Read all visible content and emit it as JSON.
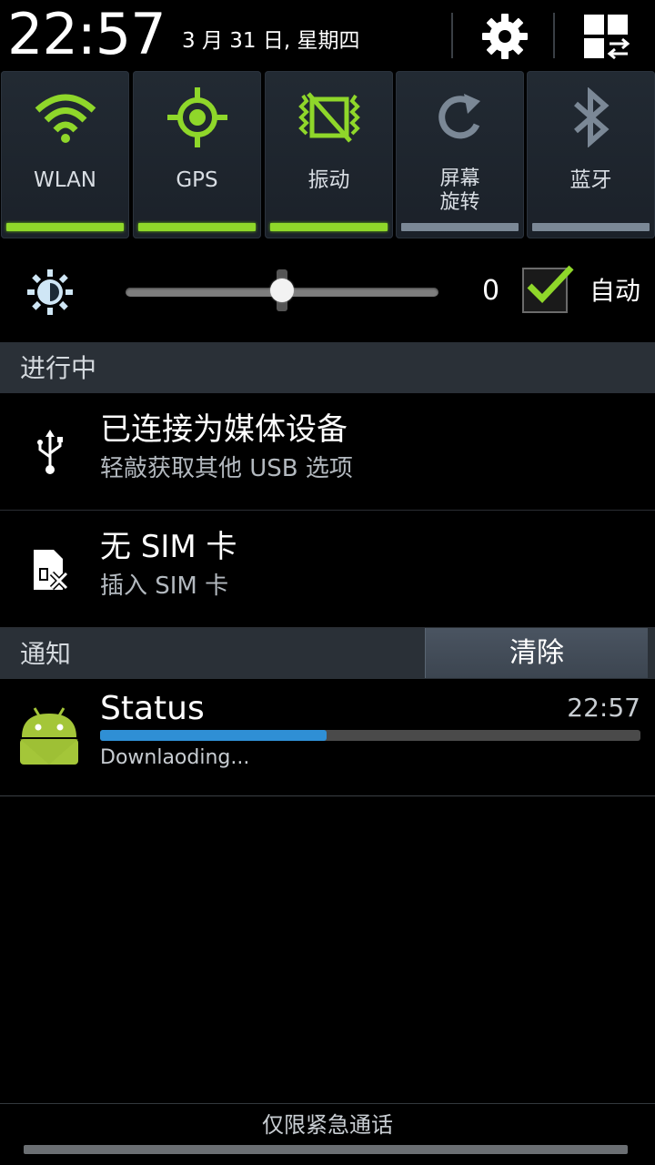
{
  "header": {
    "time": "22:57",
    "date": "3 月 31 日, 星期四",
    "icons": [
      "gear-icon",
      "grid-swap-icon"
    ]
  },
  "toggles": [
    {
      "label": "WLAN",
      "icon": "wifi-icon",
      "on": true
    },
    {
      "label": "GPS",
      "icon": "gps-icon",
      "on": true
    },
    {
      "label": "振动",
      "icon": "vibrate-icon",
      "on": true
    },
    {
      "label": "屏幕\n旋转",
      "label_line1": "屏幕",
      "label_line2": "旋转",
      "icon": "rotate-icon",
      "on": false
    },
    {
      "label": "蓝牙",
      "icon": "bluetooth-icon",
      "on": false
    }
  ],
  "brightness": {
    "value": "0",
    "auto_label": "自动",
    "auto_checked": true,
    "level": 0.5
  },
  "ongoing": {
    "header": "进行中",
    "items": [
      {
        "title": "已连接为媒体设备",
        "subtitle": "轻敲获取其他 USB 选项",
        "icon": "usb-icon"
      },
      {
        "title": "无 SIM 卡",
        "subtitle": "插入 SIM 卡",
        "icon": "no-sim-icon"
      }
    ]
  },
  "notifications": {
    "header": "通知",
    "clear_label": "清除",
    "items": [
      {
        "title": "Status",
        "time": "22:57",
        "text": "Downlaoding...",
        "progress": 0.42,
        "icon": "android-icon"
      }
    ]
  },
  "footer": {
    "carrier_text": "仅限紧急通话"
  },
  "colors": {
    "accent_green": "#8fd72a",
    "off_gray": "#7b8896",
    "progress_blue": "#2f8fd5",
    "section_bg": "#2a3037"
  }
}
